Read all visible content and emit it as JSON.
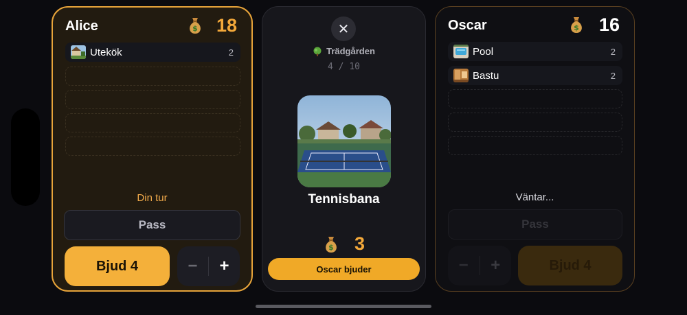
{
  "left_player": {
    "name": "Alice",
    "coins": "18",
    "items": [
      {
        "label": "Utekök",
        "count": "2"
      }
    ],
    "status": "Din tur",
    "pass_label": "Pass",
    "bid_label": "Bjud 4",
    "minus": "−",
    "plus": "+"
  },
  "auction": {
    "close": "✕",
    "category": "Trädgården",
    "progress": "4 / 10",
    "item_name": "Tennisbana",
    "price": "3",
    "bidder_label": "Oscar bjuder"
  },
  "right_player": {
    "name": "Oscar",
    "coins": "16",
    "items": [
      {
        "label": "Pool",
        "count": "2"
      },
      {
        "label": "Bastu",
        "count": "2"
      }
    ],
    "status": "Väntar...",
    "pass_label": "Pass",
    "bid_label": "Bjud 4",
    "minus": "−",
    "plus": "+"
  },
  "colors": {
    "accent": "#f0a927",
    "active_border": "#e8a43a",
    "active_bg": "#221b10",
    "panel_bg": "#17171c"
  },
  "icons": {
    "money": "money-bag-icon",
    "tree": "tree-icon",
    "close": "close-icon"
  }
}
